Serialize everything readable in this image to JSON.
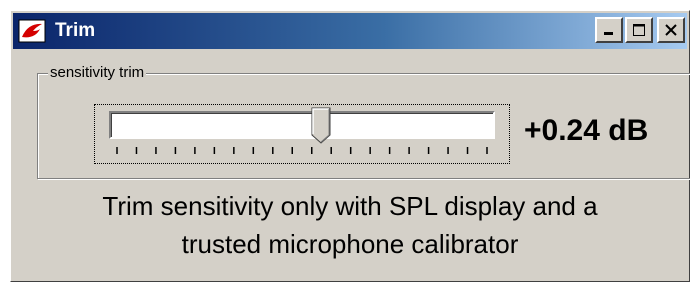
{
  "window": {
    "title": "Trim",
    "icon": "app-logo-icon",
    "buttons": [
      "minimize-icon",
      "maximize-icon",
      "close-icon"
    ]
  },
  "group": {
    "label": "sensitivity trim"
  },
  "slider": {
    "position_fraction": 0.55,
    "tick_count": 20,
    "value_text": "+0.24 dB"
  },
  "message": {
    "line1": "Trim sensitivity only with SPL display and a",
    "line2": "trusted microphone calibrator"
  }
}
